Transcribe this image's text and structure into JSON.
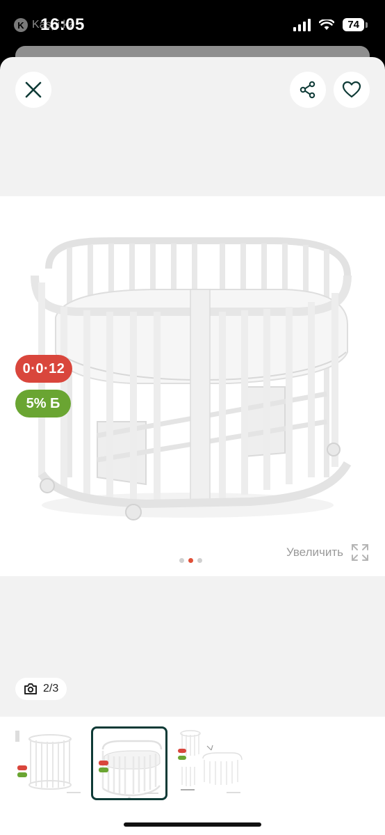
{
  "status_bar": {
    "app_label": "Kaspi.kz",
    "time": "16:05",
    "battery": "74"
  },
  "header": {
    "close_icon": "close-icon",
    "share_icon": "share-icon",
    "favorite_icon": "heart-icon"
  },
  "gallery": {
    "badge_age": "0·0·12",
    "badge_discount": "5% Б",
    "zoom_label": "Увеличить",
    "dots": [
      false,
      true,
      false
    ],
    "counter": "2/3"
  },
  "colors": {
    "badge_age": "#d9463c",
    "badge_discount": "#6aa532",
    "active_dot": "#e05038",
    "selected_thumb_border": "#0e3a36"
  }
}
